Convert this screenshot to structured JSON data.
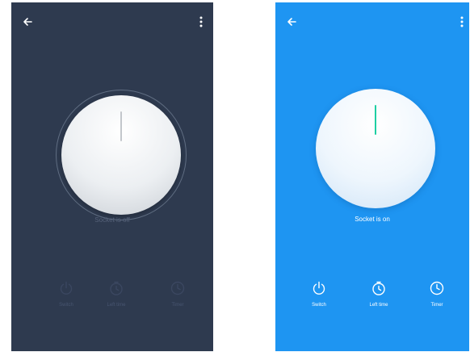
{
  "screens": [
    {
      "state": "off",
      "status_text": "Socket is off",
      "background": "#2e3a4f",
      "icon_color": "#3b4760",
      "indicator_color": "#c3c7cc",
      "controls": [
        {
          "label": "Switch",
          "icon": "power-icon"
        },
        {
          "label": "Left time",
          "icon": "stopwatch-icon"
        },
        {
          "label": "Timer",
          "icon": "clock-icon"
        }
      ]
    },
    {
      "state": "on",
      "status_text": "Socket is on",
      "background": "#1e95f2",
      "icon_color": "#ffffff",
      "indicator_color": "#1ecfa3",
      "controls": [
        {
          "label": "Switch",
          "icon": "power-icon"
        },
        {
          "label": "Left time",
          "icon": "stopwatch-icon"
        },
        {
          "label": "Timer",
          "icon": "clock-icon"
        }
      ]
    }
  ]
}
